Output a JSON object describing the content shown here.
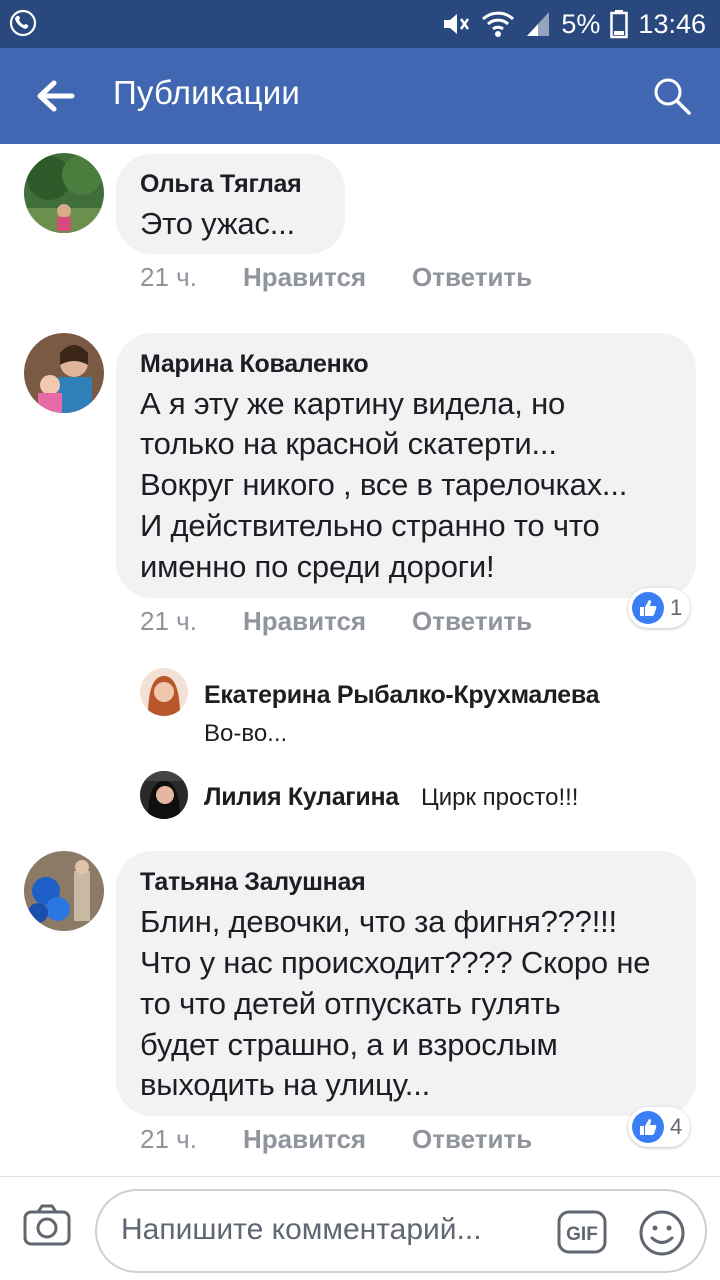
{
  "status_bar": {
    "battery": "5%",
    "time": "13:46"
  },
  "app_bar": {
    "title": "Публикации"
  },
  "comments": [
    {
      "name": "Ольга Тяглая",
      "lines": [
        "Это ужас..."
      ],
      "time": "21 ч.",
      "like": "Нравится",
      "reply": "Ответить"
    },
    {
      "name": "Марина Коваленко",
      "lines": [
        "А я эту же картину видела, но",
        "только на красной скатерти...",
        "Вокруг никого , все в тарелочках...",
        "И действительно странно то что",
        "именно по среди дороги!"
      ],
      "time": "21 ч.",
      "like": "Нравится",
      "reply": "Ответить",
      "reactions": "1"
    },
    {
      "name": "Татьяна Залушная",
      "lines": [
        "Блин, девочки, что за фигня???!!!",
        "Что у нас происходит???? Скоро не",
        "то что детей отпускать гулять",
        "будет страшно, а и взрослым",
        "выходить на улицу..."
      ],
      "time": "21 ч.",
      "like": "Нравится",
      "reply": "Ответить",
      "reactions": "4"
    }
  ],
  "replies": [
    {
      "name": "Екатерина Рыбалко-Крухмалева",
      "text": "Во-во..."
    },
    {
      "name": "Лилия Кулагина",
      "text": "Цирк просто!!!"
    }
  ],
  "composer": {
    "placeholder": "Напишите комментарий..."
  },
  "colors": {
    "status_bar": "#29487d",
    "app_bar": "#4267b2",
    "bubble": "#f1f2f4",
    "like_blue": "#3b7df2"
  }
}
